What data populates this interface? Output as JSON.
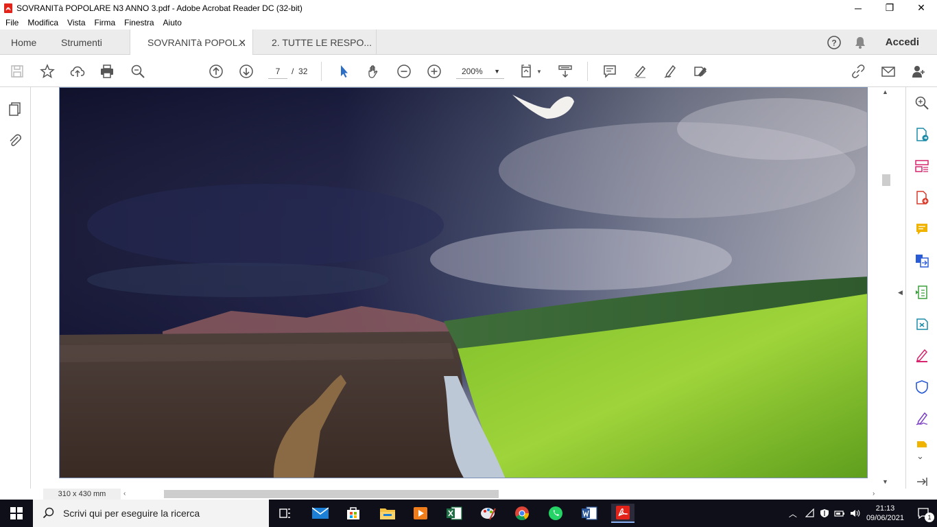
{
  "window": {
    "title": "SOVRANITà POPOLARE N3 ANNO 3.pdf - Adobe Acrobat Reader DC (32-bit)",
    "controls": {
      "minimize": "─",
      "restore": "❐",
      "close": "✕"
    }
  },
  "menu": [
    "File",
    "Modifica",
    "Vista",
    "Firma",
    "Finestra",
    "Aiuto"
  ],
  "tabs": {
    "home": "Home",
    "tools": "Strumenti",
    "doc1": "SOVRANITà POPOL...",
    "doc1_close": "✕",
    "doc2": "2. TUTTE LE RESPO...",
    "signin": "Accedi"
  },
  "toolbar": {
    "page_current": "7",
    "page_separator": "/",
    "page_total": "32",
    "zoom": "200%"
  },
  "status": {
    "page_size": "310 x 430 mm"
  },
  "taskbar": {
    "search_placeholder": "Scrivi qui per eseguire la ricerca",
    "time": "21:13",
    "date": "09/06/2021",
    "notification_count": "1"
  },
  "colors": {
    "acrobat_red": "#e2231a",
    "tab_bg": "#ececec",
    "taskbar_bg": "#0f0f1a",
    "tool_blue": "#2c6ec4",
    "page_border": "#7a8fb5"
  }
}
